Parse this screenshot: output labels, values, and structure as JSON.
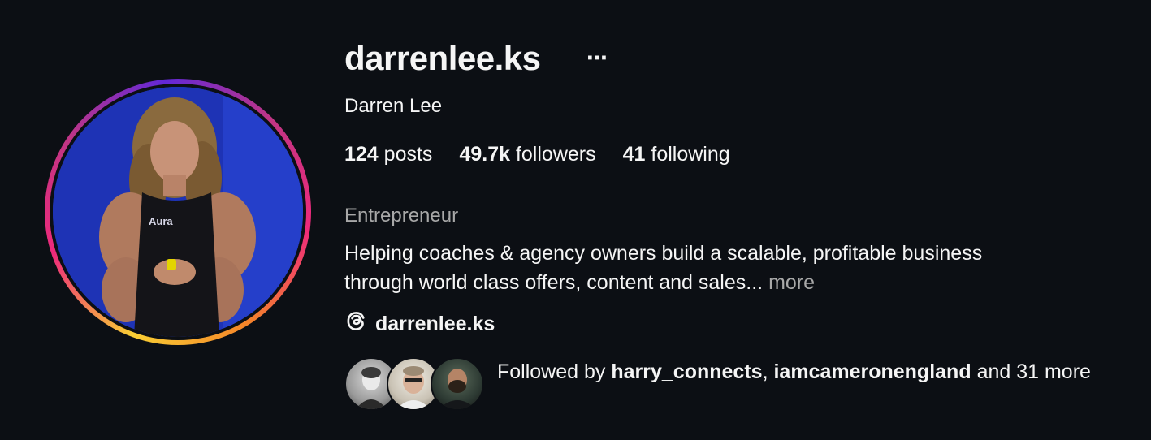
{
  "profile": {
    "username": "darrenlee.ks",
    "more_icon": "⋯",
    "full_name": "Darren Lee",
    "stats": {
      "posts_count": "124",
      "posts_label": "posts",
      "followers_count": "49.7k",
      "followers_label": "followers",
      "following_count": "41",
      "following_label": "following"
    },
    "category": "Entrepreneur",
    "bio_line1": "Helping coaches & agency owners build a scalable, profitable business",
    "bio_line2": "through world class offers, content and sales...",
    "bio_more": "more",
    "threads_handle": "darrenlee.ks",
    "avatar_shirt_text": "Aura",
    "followed_by": {
      "prefix": "Followed by",
      "user1": "harry_connects",
      "separator": ",",
      "user2": "iamcameronengland",
      "suffix": "and 31 more"
    }
  },
  "colors": {
    "background": "#0c0f14",
    "text": "#f5f5f5",
    "muted": "#a8a8a8"
  }
}
